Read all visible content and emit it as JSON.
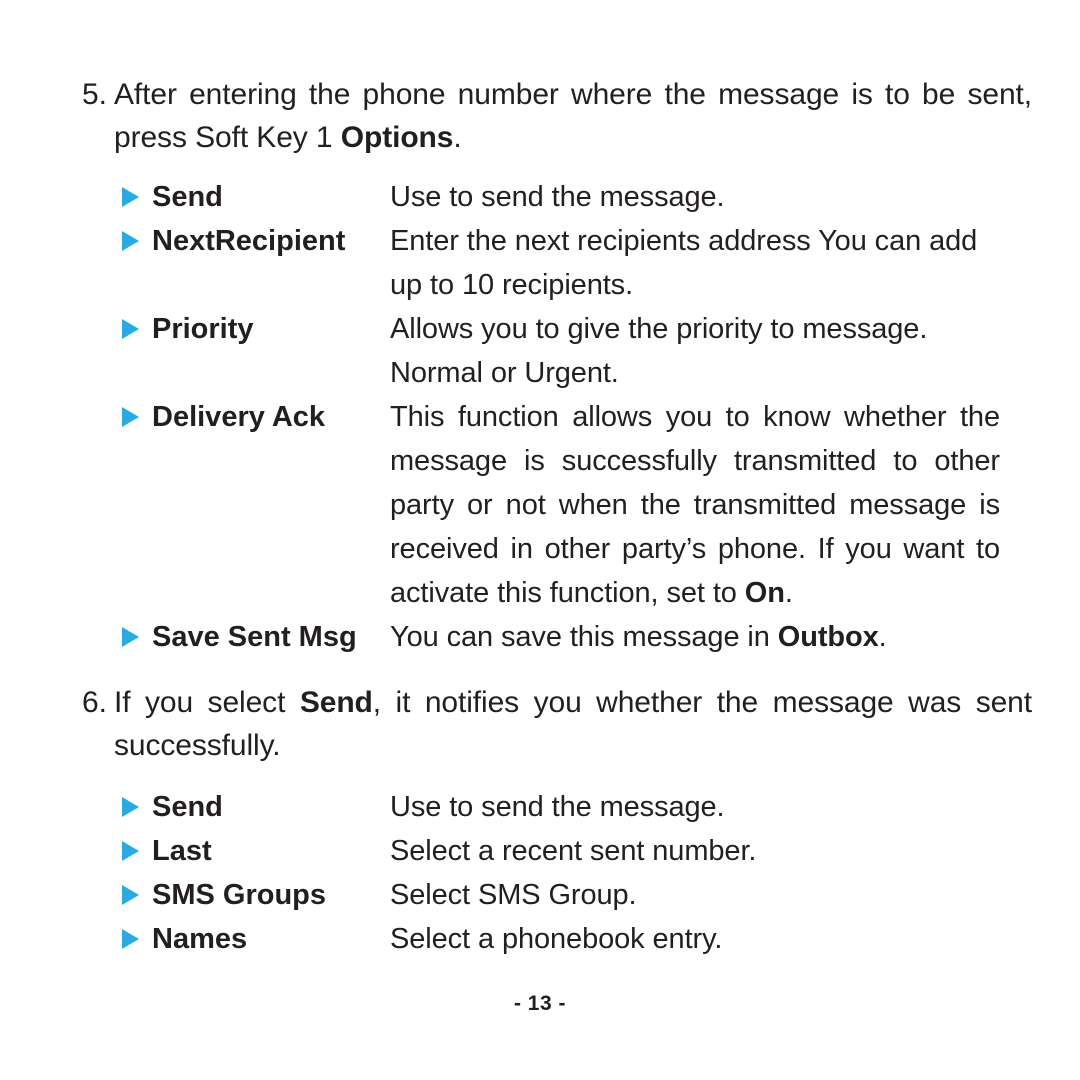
{
  "page": {
    "footer": "- 13 -",
    "accent_color": "#29abe2",
    "text_color": "#231f20",
    "background_color": "#ffffff"
  },
  "steps": [
    {
      "number": "5.",
      "text_before_bold": "After entering the phone number where the message is to be sent, press Soft Key 1 ",
      "bold": "Options",
      "text_after_bold": "."
    },
    {
      "number": "6.",
      "text_before_bold": "If you select ",
      "bold": "Send",
      "text_after_bold": ", it notifies you whether the message was sent successfully."
    }
  ],
  "options_list": [
    {
      "term": "Send",
      "desc": "Use to send the message."
    },
    {
      "term": "NextRecipient",
      "desc": "Enter the next recipients address You can add up to 10 recipients."
    },
    {
      "term": "Priority",
      "desc": "Allows you to give the priority to message. Normal or Urgent."
    },
    {
      "term": "Delivery Ack",
      "desc_before_bold": "This function allows you to know whether the message is successfully transmitted to other party or not when the transmitted message is received in other party’s phone. If you want to activate this function, set to ",
      "desc_bold": "On",
      "desc_after_bold": "."
    },
    {
      "term": "Save Sent Msg",
      "desc_before_bold": "You can save this message in ",
      "desc_bold": "Outbox",
      "desc_after_bold": "."
    }
  ],
  "send_list": [
    {
      "term": "Send",
      "desc": "Use to send the message."
    },
    {
      "term": "Last",
      "desc": "Select a recent sent number."
    },
    {
      "term": "SMS Groups",
      "desc": "Select SMS Group."
    },
    {
      "term": "Names",
      "desc": "Select a phonebook entry."
    }
  ]
}
